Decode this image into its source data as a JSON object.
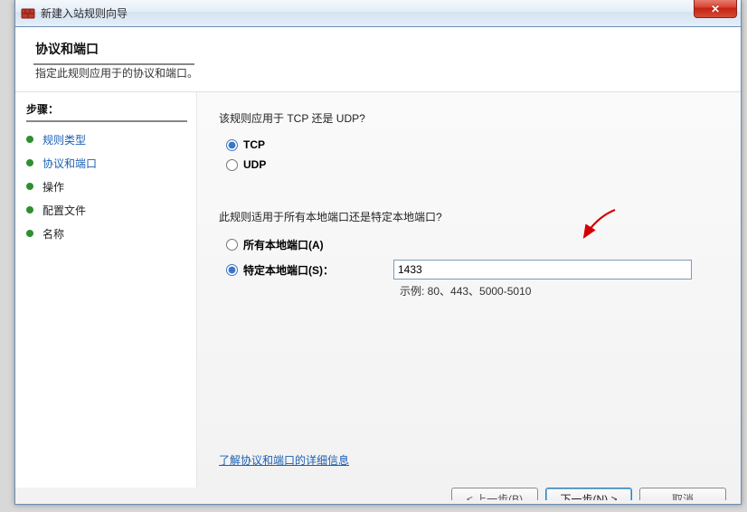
{
  "window": {
    "title": "新建入站规则向导"
  },
  "header": {
    "title": "协议和端口",
    "subtitle": "指定此规则应用于的协议和端口。"
  },
  "sidebar": {
    "steps_label": "步骤：",
    "items": [
      {
        "label": "规则类型",
        "state": "done",
        "link": true
      },
      {
        "label": "协议和端口",
        "state": "current",
        "link": true
      },
      {
        "label": "操作",
        "state": "pending",
        "link": false
      },
      {
        "label": "配置文件",
        "state": "pending",
        "link": false
      },
      {
        "label": "名称",
        "state": "pending",
        "link": false
      }
    ]
  },
  "main": {
    "protocol_prompt": "该规则应用于 TCP 还是 UDP?",
    "tcp_label": "TCP",
    "udp_label": "UDP",
    "protocol_selected": "tcp",
    "scope_prompt": "此规则适用于所有本地端口还是特定本地端口?",
    "all_ports_label": "所有本地端口(A)",
    "specific_ports_label": "特定本地端口(S)：",
    "scope_selected": "specific",
    "port_value": "1433",
    "example_label": "示例: 80、443、5000-5010",
    "more_info_label": "了解协议和端口的详细信息"
  },
  "buttons": {
    "back": "< 上一步(B)",
    "next": "下一步(N) >",
    "cancel": "取消"
  }
}
